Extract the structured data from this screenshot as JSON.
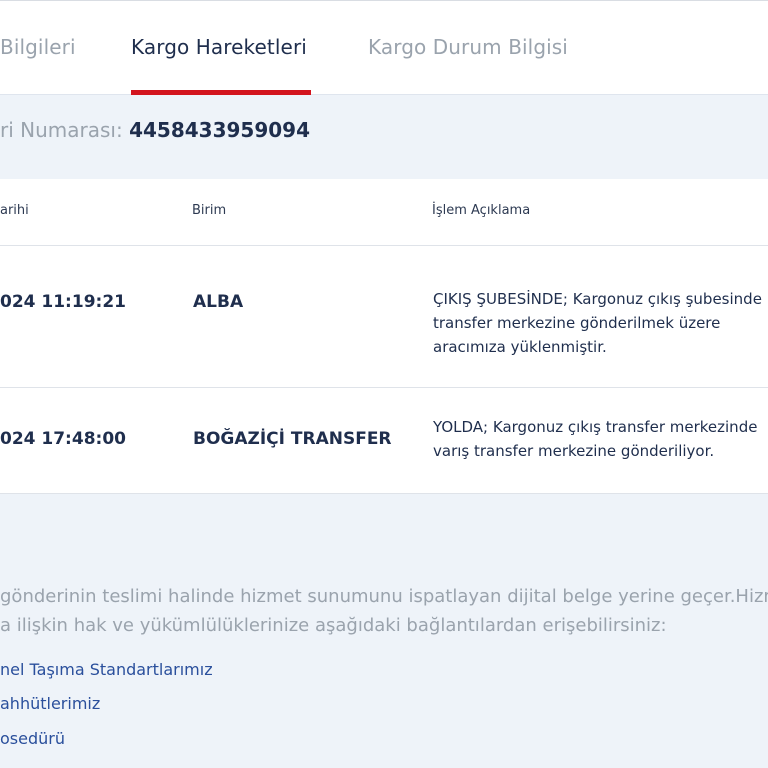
{
  "tabs": [
    {
      "label": "Bilgileri",
      "active": false
    },
    {
      "label": "Kargo Hareketleri",
      "active": true
    },
    {
      "label": "Kargo Durum Bilgisi",
      "active": false
    }
  ],
  "tracking": {
    "label": "ri Numarası:",
    "value": "4458433959094"
  },
  "table": {
    "headers": [
      "arihi",
      "Birim",
      "İşlem Açıklama"
    ],
    "rows": [
      {
        "date": "024 11:19:21",
        "unit": "ALBA",
        "description": [
          "ÇIKIŞ ŞUBESİNDE; Kargonuz çıkış şubesinde",
          "transfer merkezine gönderilmek üzere",
          "aracımıza yüklenmiştir."
        ]
      },
      {
        "date": "024 17:48:00",
        "unit": "BOĞAZİÇİ TRANSFER",
        "description": [
          "YOLDA; Kargonuz çıkış transfer merkezinde",
          "varış transfer merkezine gönderiliyor."
        ]
      }
    ]
  },
  "notice": [
    "gönderinin teslimi halinde hizmet sunumunu ispatlayan dijital belge yerine geçer.Hizm",
    "a ilişkin hak ve yükümlülüklerinize aşağıdaki bağlantılardan erişebilirsiniz:"
  ],
  "links": [
    "nel Taşıma Standartlarımız",
    "ahhütlerimiz",
    "osedürü"
  ],
  "colors": {
    "accent": "#d3141e",
    "text": "#1f2e4d",
    "muted": "#9aa3ad",
    "link": "#2a4f9c",
    "background": "#eef3f9"
  }
}
